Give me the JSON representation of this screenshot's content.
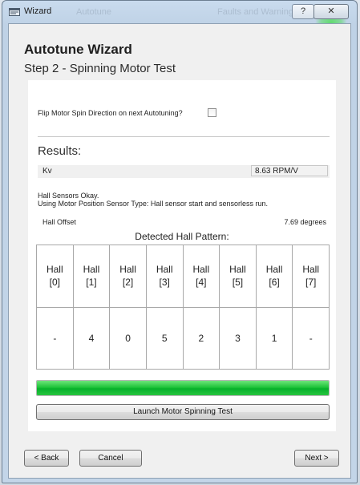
{
  "window": {
    "title": "Wizard",
    "background_tab_1": "Autotune",
    "background_tab_2": "Faults and Warnings",
    "help_glyph": "?",
    "close_glyph": "✕"
  },
  "header": {
    "title": "Autotune Wizard",
    "step": "Step 2 - Spinning Motor Test"
  },
  "options": {
    "flip_label": "Flip Motor Spin Direction on next Autotuning?",
    "flip_checked": false
  },
  "results": {
    "label": "Results:",
    "kv_label": "Kv",
    "kv_value": "8.63 RPM/V",
    "status_line1": "Hall Sensors Okay.",
    "status_line2": "Using Motor Position Sensor Type: Hall sensor start and sensorless run.",
    "hall_offset_label": "Hall Offset",
    "hall_offset_value": "7.69 degrees",
    "pattern_title": "Detected Hall Pattern:",
    "hall_headers": [
      [
        "Hall",
        "[0]"
      ],
      [
        "Hall",
        "[1]"
      ],
      [
        "Hall",
        "[2]"
      ],
      [
        "Hall",
        "[3]"
      ],
      [
        "Hall",
        "[4]"
      ],
      [
        "Hall",
        "[5]"
      ],
      [
        "Hall",
        "[6]"
      ],
      [
        "Hall",
        "[7]"
      ]
    ],
    "hall_values": [
      "-",
      "4",
      "0",
      "5",
      "2",
      "3",
      "1",
      "-"
    ]
  },
  "progress": {
    "percent": 100,
    "color": "#1fc43a"
  },
  "buttons": {
    "launch": "Launch Motor Spinning Test",
    "back": "< Back",
    "cancel": "Cancel",
    "next": "Next >"
  },
  "icons": {
    "window_icon": "wizard-window-icon"
  }
}
